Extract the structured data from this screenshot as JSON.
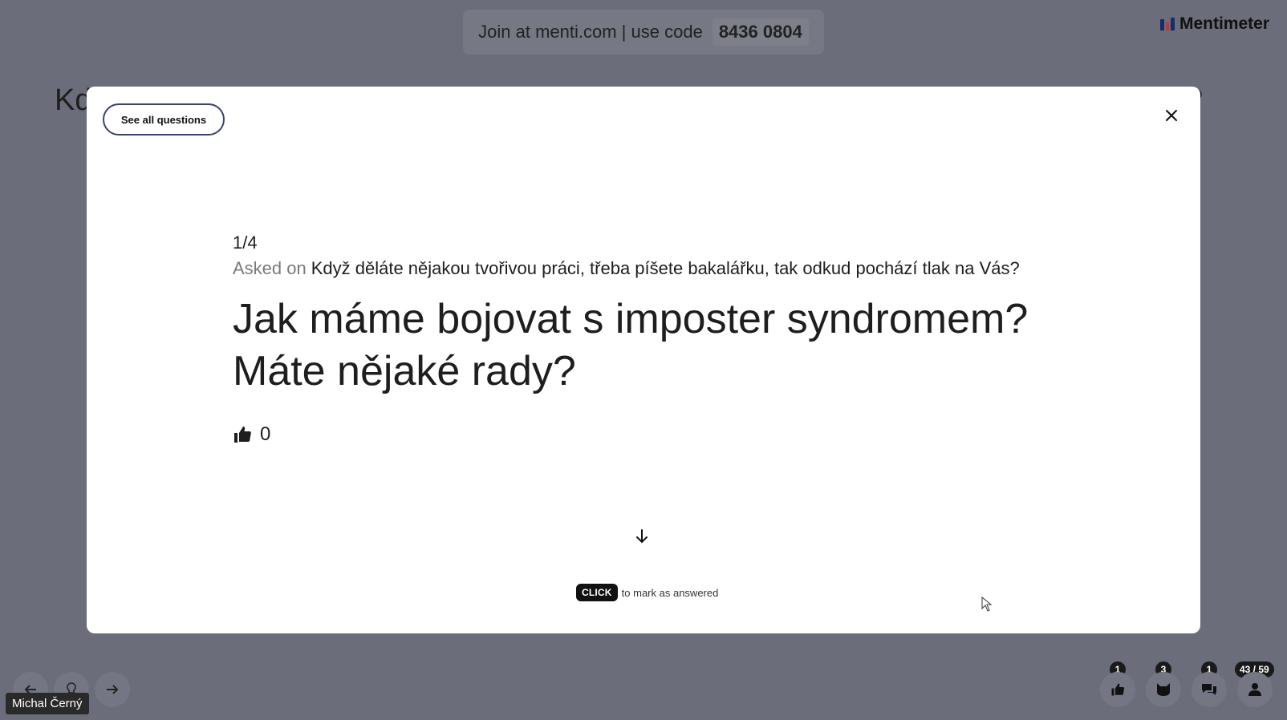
{
  "join_bar": {
    "text": "Join at menti.com | use code",
    "code": "8436 0804"
  },
  "brand": {
    "name": "Mentimeter"
  },
  "background_slide": {
    "title_start": "Kd",
    "title_end": "?"
  },
  "modal": {
    "see_all_label": "See all questions",
    "close_icon": "close-icon",
    "counter": "1/4",
    "asked_prefix": "Asked on",
    "asked_source": "Když děláte nějakou tvořivou práci, třeba píšete bakalářku, tak odkud pochází tlak na Vás?",
    "question": "Jak máme bojovat s imposter syndromem? Máte nějaké rady?",
    "likes": "0",
    "hint_key": "CLICK",
    "hint_text": "to mark as answered"
  },
  "bottom_bar": {
    "presenter_name": "Michal Černý",
    "badges": {
      "likes": "1",
      "reactions": "3",
      "comments": "1",
      "participants": "43 / 59"
    }
  },
  "colors": {
    "backdrop": "#6b6e7a",
    "modal": "#ffffff",
    "accent_border": "#3b4078"
  }
}
